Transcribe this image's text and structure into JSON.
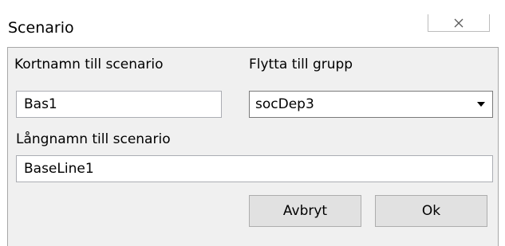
{
  "window": {
    "title": "Scenario",
    "close_icon": "close-icon"
  },
  "form": {
    "short_name_label": "Kortnamn till scenario",
    "short_name_value": "Bas1",
    "group_label": "Flytta till grupp",
    "group_value": "socDep3",
    "group_dropdown_icon": "dropdown-arrow-icon",
    "long_name_label": "Långnamn till scenario",
    "long_name_value": "BaseLine1"
  },
  "buttons": {
    "cancel_label": "Avbryt",
    "ok_label": "Ok"
  }
}
